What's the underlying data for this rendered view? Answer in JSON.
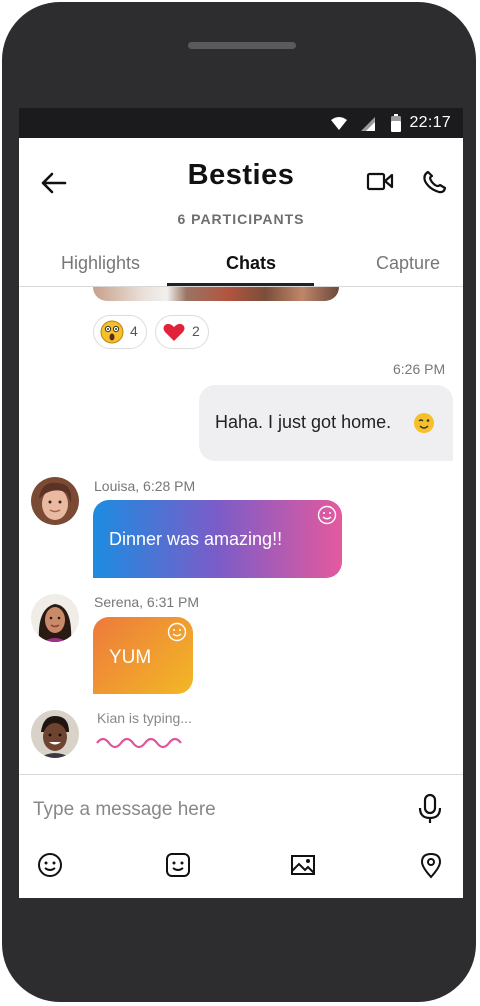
{
  "status_bar": {
    "time": "22:17",
    "icons": [
      "wifi-icon",
      "signal-icon",
      "battery-icon"
    ]
  },
  "header": {
    "title": "Besties",
    "subtitle": "6 PARTICIPANTS",
    "back_icon": "back-arrow-icon",
    "video_icon": "video-call-icon",
    "call_icon": "phone-call-icon"
  },
  "tabs": [
    {
      "label": "Highlights"
    },
    {
      "label": "Chats",
      "active": true
    },
    {
      "label": "Capture"
    }
  ],
  "reactions": [
    {
      "icon": "shocked-emoji-icon",
      "count": "4"
    },
    {
      "icon": "heart-emoji-icon",
      "count": "2"
    }
  ],
  "messages": [
    {
      "type": "outgoing",
      "time": "6:26 PM",
      "text": "Haha. I just got home.",
      "emoji": "wink-emoji-icon"
    },
    {
      "type": "incoming",
      "sender": "Louisa, 6:28 PM",
      "text": "Dinner was amazing!!"
    },
    {
      "type": "incoming",
      "sender": "Serena, 6:31 PM",
      "text": "YUM"
    }
  ],
  "typing": {
    "text": "Kian is typing..."
  },
  "composer": {
    "placeholder": "Type a message here",
    "mic_icon": "microphone-icon",
    "toolbar": [
      "emoji-icon",
      "sticker-icon",
      "image-icon",
      "location-icon"
    ]
  },
  "colors": {
    "gradient_start": "#1c8ce0",
    "gradient_end": "#e45a9e",
    "yum_start": "#ed7a3c",
    "yum_end": "#f2b825",
    "typing_squiggle": "#e0559b"
  }
}
